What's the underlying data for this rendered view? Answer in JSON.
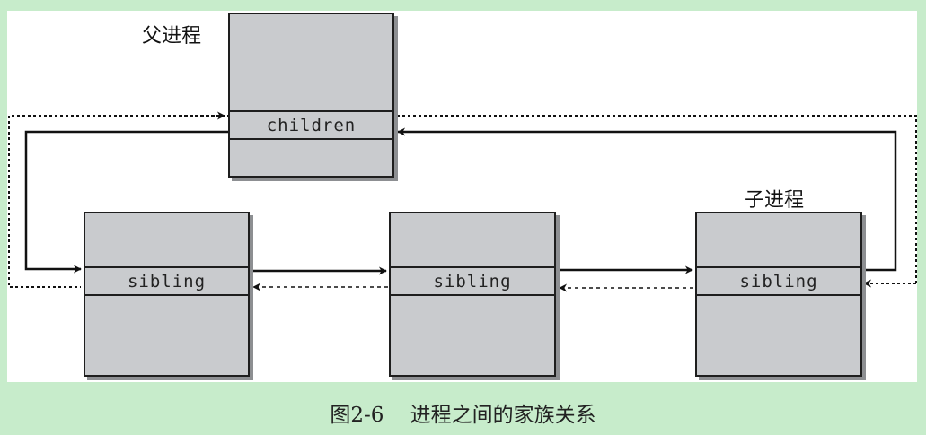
{
  "labels": {
    "parent": "父进程",
    "child": "子进程"
  },
  "parent_box": {
    "field_label": "children"
  },
  "child_boxes": [
    {
      "field_label": "sibling"
    },
    {
      "field_label": "sibling"
    },
    {
      "field_label": "sibling"
    }
  ],
  "caption": "图2-6    进程之间的家族关系",
  "colors": {
    "page_background": "#c7eccb",
    "box_fill": "#c9cbce",
    "line": "#111111"
  }
}
